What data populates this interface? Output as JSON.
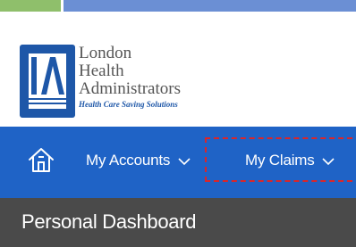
{
  "brand": {
    "name_lines": [
      "London",
      "Health",
      "Administrators"
    ],
    "tagline": "Health Care Saving Solutions",
    "logo_colors": {
      "mark": "#1e57a8",
      "text": "#555555"
    }
  },
  "nav": {
    "background": "#1f63c6",
    "home_icon": "home-icon",
    "items": [
      {
        "label": "My Accounts",
        "icon": "chevron-down-icon"
      },
      {
        "label": "My Claims",
        "icon": "chevron-down-icon",
        "highlighted": true
      }
    ],
    "highlight_color": "#d9262a"
  },
  "subheader": {
    "title": "Personal Dashboard",
    "background": "#4a4a4a"
  }
}
